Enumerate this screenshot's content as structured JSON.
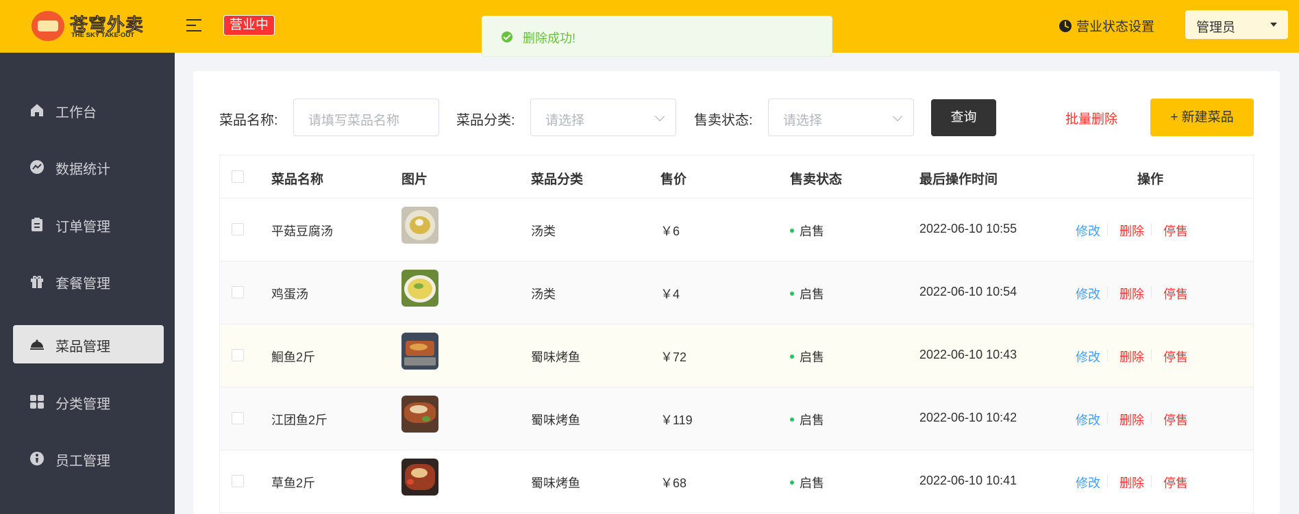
{
  "header": {
    "logo_cn": "苍穹外卖",
    "logo_en": "THE SKY TAKE-OUT",
    "status_tag": "营业中",
    "status_setting": "营业状态设置",
    "user_menu": "管理员"
  },
  "toast": {
    "message": "删除成功!"
  },
  "sidebar": {
    "items": [
      {
        "label": "工作台",
        "icon": "home-icon"
      },
      {
        "label": "数据统计",
        "icon": "chart-icon"
      },
      {
        "label": "订单管理",
        "icon": "clipboard-icon"
      },
      {
        "label": "套餐管理",
        "icon": "gift-icon"
      },
      {
        "label": "菜品管理",
        "icon": "cloche-icon",
        "active": true
      },
      {
        "label": "分类管理",
        "icon": "grid-icon"
      },
      {
        "label": "员工管理",
        "icon": "employee-icon"
      }
    ]
  },
  "filters": {
    "name_label": "菜品名称:",
    "name_placeholder": "请填写菜品名称",
    "category_label": "菜品分类:",
    "category_placeholder": "请选择",
    "status_label": "售卖状态:",
    "status_placeholder": "请选择",
    "query_button": "查询",
    "batch_delete": "批量删除",
    "new_dish": "+ 新建菜品"
  },
  "table": {
    "columns": [
      "菜品名称",
      "图片",
      "菜品分类",
      "售价",
      "售卖状态",
      "最后操作时间",
      "操作"
    ],
    "rows": [
      {
        "name": "平菇豆腐汤",
        "category": "汤类",
        "price": "￥6",
        "status": "启售",
        "time": "2022-06-10 10:55",
        "edit": "修改",
        "delete": "删除",
        "toggle": "停售"
      },
      {
        "name": "鸡蛋汤",
        "category": "汤类",
        "price": "￥4",
        "status": "启售",
        "time": "2022-06-10 10:54",
        "edit": "修改",
        "delete": "删除",
        "toggle": "停售"
      },
      {
        "name": "鮰鱼2斤",
        "category": "蜀味烤鱼",
        "price": "￥72",
        "status": "启售",
        "time": "2022-06-10 10:43",
        "edit": "修改",
        "delete": "删除",
        "toggle": "停售"
      },
      {
        "name": "江团鱼2斤",
        "category": "蜀味烤鱼",
        "price": "￥119",
        "status": "启售",
        "time": "2022-06-10 10:42",
        "edit": "修改",
        "delete": "删除",
        "toggle": "停售"
      },
      {
        "name": "草鱼2斤",
        "category": "蜀味烤鱼",
        "price": "￥68",
        "status": "启售",
        "time": "2022-06-10 10:41",
        "edit": "修改",
        "delete": "删除",
        "toggle": "停售"
      }
    ]
  },
  "colors": {
    "brand": "#ffc200",
    "sidebar": "#343744",
    "danger": "#fd3333",
    "link": "#419eff",
    "success": "#67c23a",
    "status_dot": "#22c55e"
  }
}
